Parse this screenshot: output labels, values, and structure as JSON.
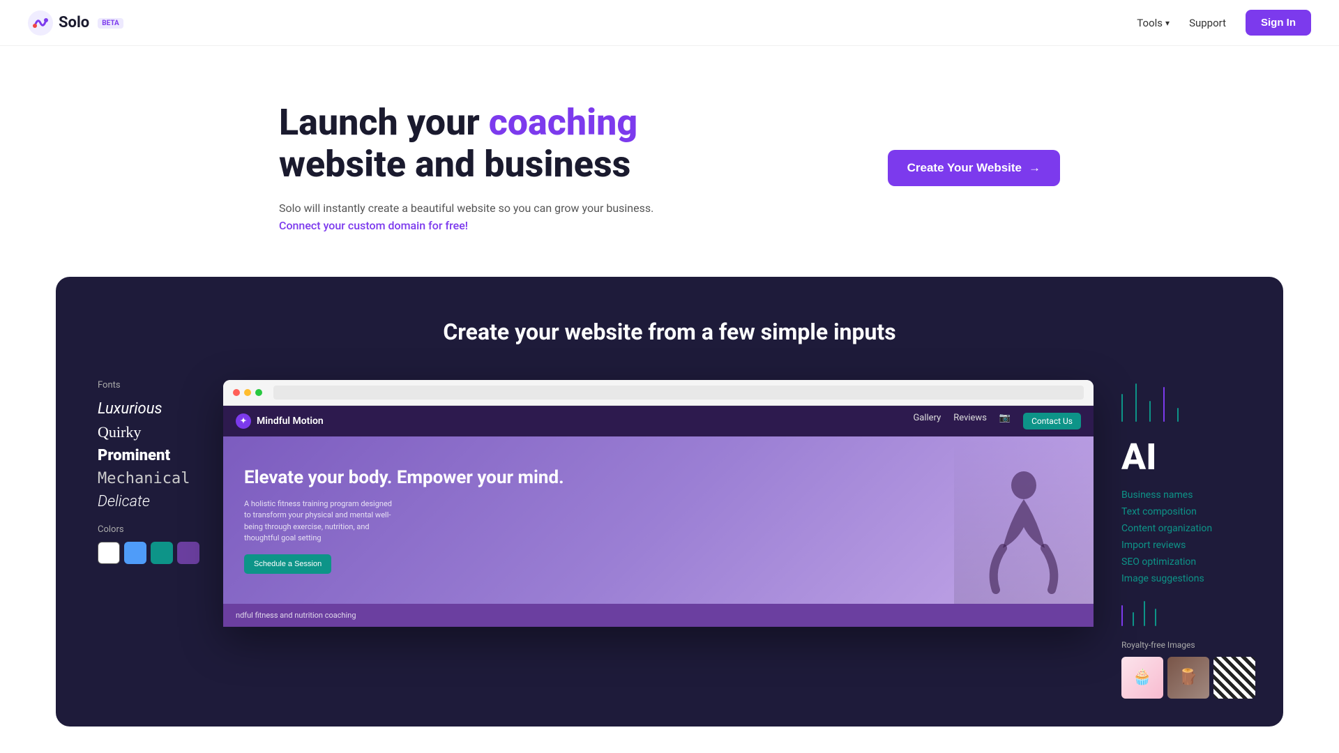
{
  "nav": {
    "logo_text": "Solo",
    "beta": "BETA",
    "tools_label": "Tools",
    "support_label": "Support",
    "signin_label": "Sign In"
  },
  "hero": {
    "headline_part1": "Launch your ",
    "headline_accent": "coaching",
    "headline_part2": "website and business",
    "subtext": "Solo will instantly create a beautiful website so you can grow your business.",
    "link_text": "Connect your custom domain for free!",
    "cta_label": "Create Your Website",
    "cta_arrow": "→"
  },
  "dark_section": {
    "title": "Create your website from a few simple inputs",
    "fonts_label": "Fonts",
    "fonts": [
      {
        "label": "Luxurious",
        "style": "luxurious"
      },
      {
        "label": "Quirky",
        "style": "quirky"
      },
      {
        "label": "Prominent",
        "style": "prominent"
      },
      {
        "label": "Mechanical",
        "style": "mechanical"
      },
      {
        "label": "Delicate",
        "style": "delicate"
      }
    ],
    "colors_label": "Colors",
    "swatches": [
      "#ffffff",
      "#4f9cf9",
      "#0d9488",
      "#6b3fa0"
    ],
    "browser": {
      "brand": "Mindful Motion",
      "nav_links": [
        "Gallery",
        "Reviews"
      ],
      "contact_btn": "Contact Us",
      "hero_headline": "Elevate your body. Empower your mind.",
      "hero_p": "A holistic fitness training program designed to transform your physical and mental well-being through exercise, nutrition, and thoughtful goal setting",
      "schedule_btn": "Schedule a Session",
      "footer_text": "ndful fitness and nutrition coaching"
    },
    "ai_label": "AI",
    "ai_features": [
      "Business names",
      "Text composition",
      "Content organization",
      "Import reviews",
      "SEO optimization",
      "Image suggestions"
    ],
    "royalty_label": "Royalty-free Images"
  }
}
